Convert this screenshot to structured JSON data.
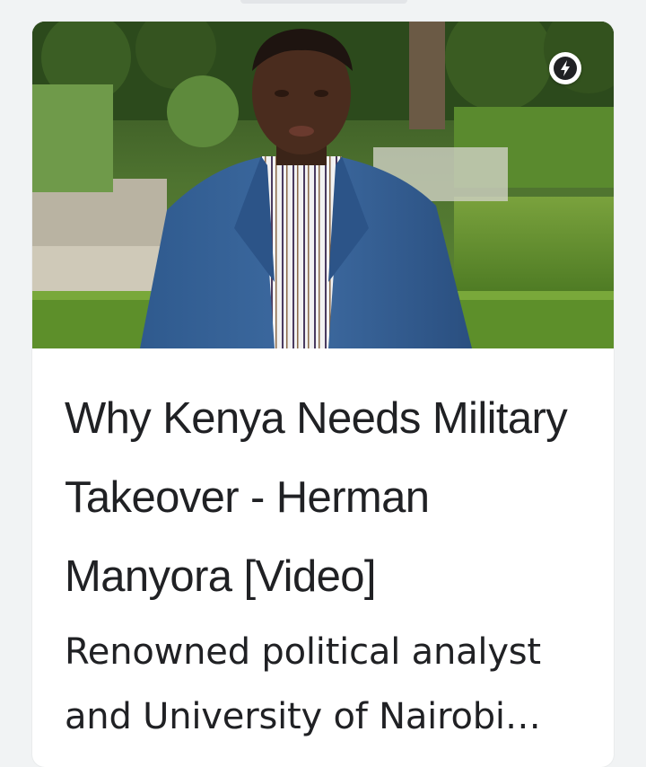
{
  "article": {
    "title": "Why Kenya Needs Military Takeover - Herman Manyora [Video]",
    "snippet": "Renowned political analyst and University of Nairobi lecturer Herman Manyora",
    "thumbnail_icon": "person-in-garden-photo",
    "badge_icon": "amp-lightning-icon"
  },
  "colors": {
    "background": "#f1f3f4",
    "card": "#ffffff",
    "text": "#202124"
  }
}
